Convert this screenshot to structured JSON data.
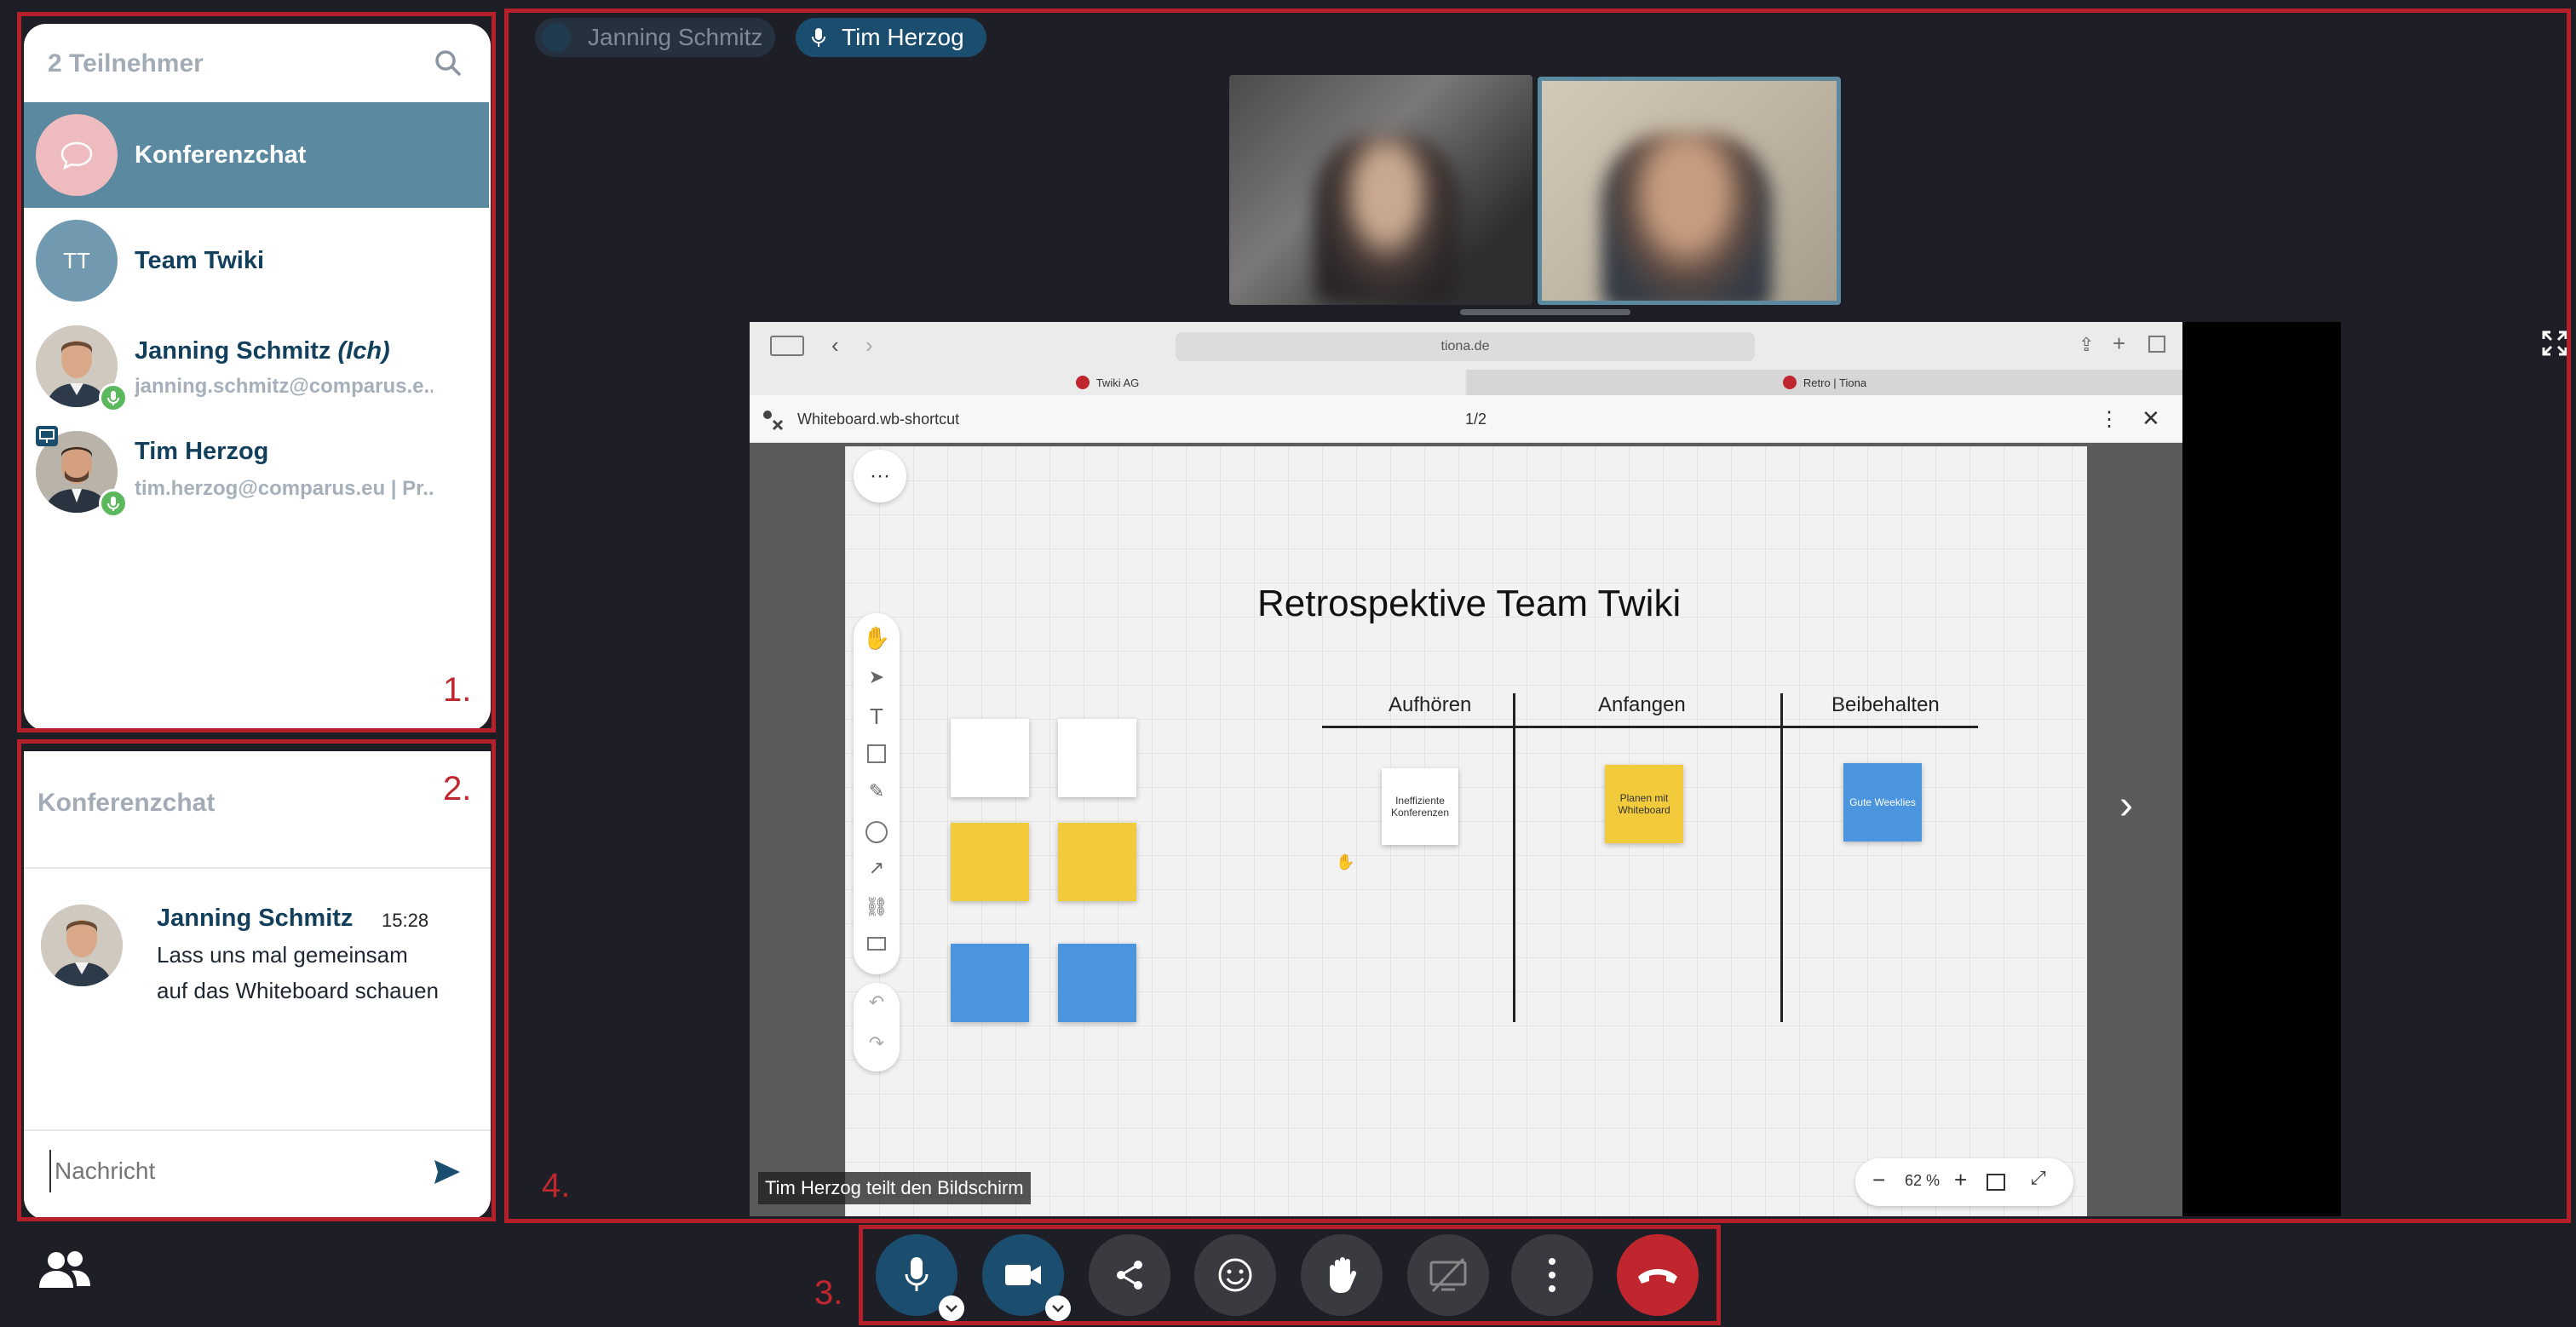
{
  "participants": {
    "header": "2 Teilnehmer",
    "items": [
      {
        "name": "Konferenzchat",
        "initials": "",
        "sub": ""
      },
      {
        "name": "Team Twiki",
        "initials": "TT",
        "sub": ""
      },
      {
        "name": "Janning Schmitz",
        "suffix": "(Ich)",
        "sub": "janning.schmitz@comparus.e..."
      },
      {
        "name": "Tim Herzog",
        "sub": "tim.herzog@comparus.eu | Pr..."
      }
    ]
  },
  "chat": {
    "title": "Konferenzchat",
    "messages": [
      {
        "author": "Janning Schmitz",
        "time": "15:28",
        "text_line1": "Lass uns mal gemeinsam",
        "text_line2": "auf das Whiteboard schauen"
      }
    ],
    "input_placeholder": "Nachricht"
  },
  "stage": {
    "speakers": [
      {
        "name": "Janning Schmitz",
        "active": false
      },
      {
        "name": "Tim Herzog",
        "active": true
      }
    ],
    "share_label": "Tim Herzog teilt den Bildschirm"
  },
  "browser": {
    "url": "tiona.de",
    "tabs": [
      "Twiki AG",
      "Retro | Tiona"
    ],
    "file_name": "Whiteboard.wb-shortcut",
    "page": "1/2"
  },
  "whiteboard": {
    "title": "Retrospektive Team Twiki",
    "columns": [
      "Aufhören",
      "Anfangen",
      "Beibehalten"
    ],
    "notes": [
      {
        "text": "Ineffiziente Konferenzen",
        "color": "#ffffff"
      },
      {
        "text": "Planen mit Whiteboard",
        "color": "#f2cb3c"
      },
      {
        "text": "Gute Weeklies",
        "color": "#4a95de"
      }
    ],
    "zoom": "62 %"
  },
  "markers": [
    "1.",
    "2.",
    "3.",
    "4."
  ],
  "colors": {
    "background": "#1e1f26",
    "selected_row": "#5b899f",
    "brand_blue": "#1b4e6e",
    "hangup_red": "#c0262d",
    "annotation_red": "#b5202a",
    "sticky_yellow": "#f2cb3c",
    "sticky_blue": "#4a95de"
  }
}
